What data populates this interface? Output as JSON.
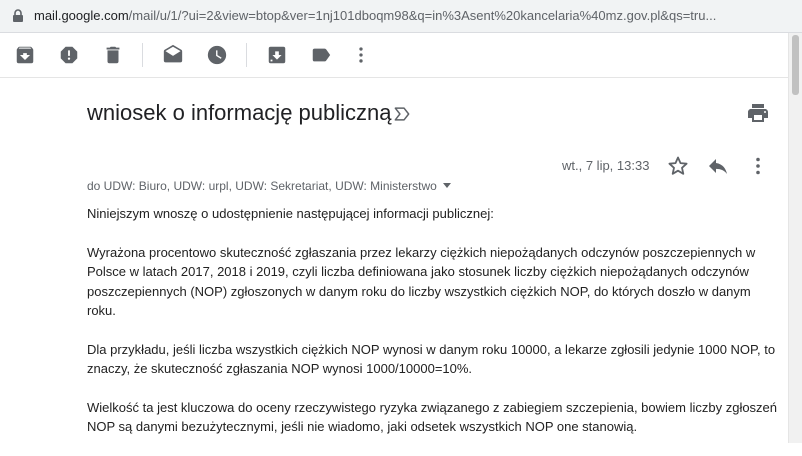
{
  "address_bar": {
    "host": "mail.google.com",
    "path": "/mail/u/1/?ui=2&view=btop&ver=1nj101dboqm98&q=in%3Asent%20kancelaria%40mz.gov.pl&qs=tru..."
  },
  "toolbar": {
    "icons": [
      "archive-icon",
      "report-spam-icon",
      "delete-icon",
      "mark-unread-icon",
      "snooze-icon",
      "move-to-icon",
      "label-icon",
      "more-vert-icon"
    ]
  },
  "email": {
    "subject": "wniosek o informację publiczną",
    "date": "wt., 7 lip, 13:33",
    "recipients": "do UDW: Biuro, UDW: urpl, UDW: Sekretariat, UDW: Ministerstwo",
    "paragraphs": [
      "Niniejszym wnoszę o udostępnienie następującej informacji publicznej:",
      "Wyrażona procentowo skuteczność zgłaszania przez lekarzy ciężkich niepożądanych odczynów poszczepiennych w Polsce w latach 2017, 2018 i 2019, czyli liczba definiowana jako stosunek liczby ciężkich niepożądanych odczynów poszczepiennych (NOP) zgłoszonych w danym roku do liczby wszystkich ciężkich NOP, do których doszło w danym roku.",
      "Dla przykładu, jeśli liczba wszystkich ciężkich NOP wynosi w danym roku 10000, a lekarze zgłosili jedynie 1000 NOP, to znaczy, że skuteczność zgłaszania NOP wynosi 1000/10000=10%.",
      "Wielkość ta jest kluczowa do oceny rzeczywistego ryzyka związanego z zabiegiem szczepienia, bowiem liczby zgłoszeń NOP są danymi bezużytecznymi, jeśli nie wiadomo, jaki odsetek wszystkich NOP one stanowią."
    ]
  },
  "colors": {
    "icon": "#5f6368",
    "text": "#222222",
    "urlbar_bg": "#f1f3f4"
  }
}
